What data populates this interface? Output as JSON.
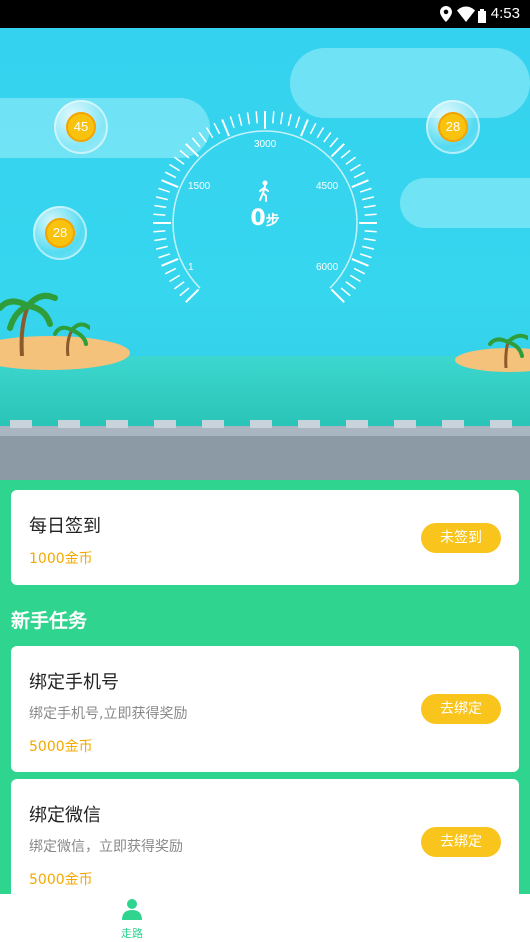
{
  "status_bar": {
    "time": "4:53"
  },
  "hero": {
    "bubbles": [
      {
        "value": "45"
      },
      {
        "value": "28"
      },
      {
        "value": "28"
      }
    ],
    "gauge": {
      "steps_value": "0",
      "steps_unit": "步",
      "scale_labels": [
        "1",
        "1500",
        "3000",
        "4500",
        "6000"
      ],
      "walker_icon": "walking-person-icon"
    }
  },
  "daily_signin": {
    "title": "每日签到",
    "reward": "1000金币",
    "button": "未签到"
  },
  "newbie_tasks": {
    "section_title": "新手任务",
    "tasks": [
      {
        "title": "绑定手机号",
        "desc": "绑定手机号,立即获得奖励",
        "reward": "5000金币",
        "button": "去绑定"
      },
      {
        "title": "绑定微信",
        "desc": "绑定微信，立即获得奖励",
        "reward": "5000金币",
        "button": "去绑定"
      }
    ]
  },
  "tabbar": {
    "items": [
      {
        "label": "走路",
        "icon": "person-icon",
        "active": true
      }
    ]
  },
  "colors": {
    "brand_green": "#2fd48f",
    "button_yellow": "#f9c51d",
    "reward_orange": "#f2a900"
  }
}
